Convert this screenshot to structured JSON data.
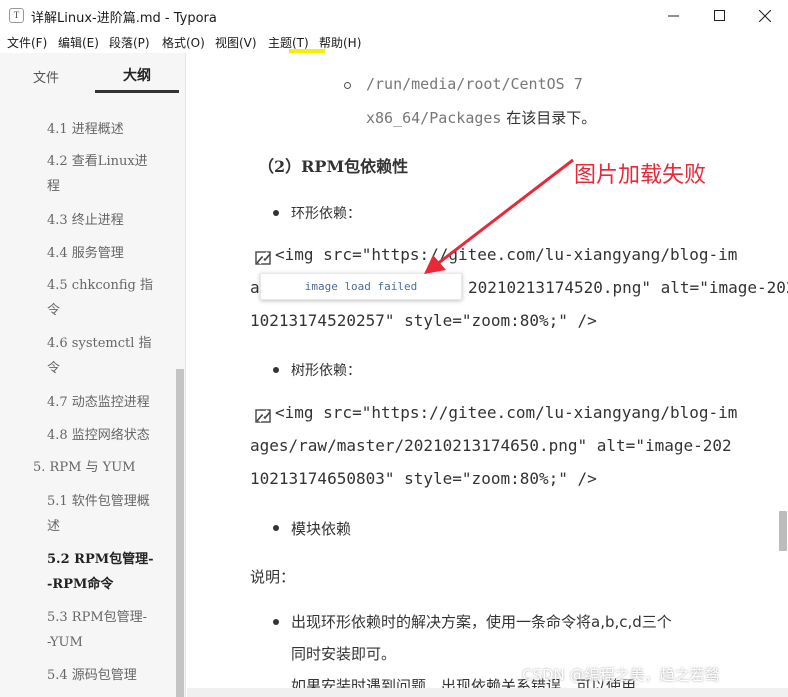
{
  "window": {
    "app_icon_letter": "T",
    "title": "详解Linux-进阶篇.md - Typora"
  },
  "menu": [
    "文件(F)",
    "编辑(E)",
    "段落(P)",
    "格式(O)",
    "视图(V)",
    "主题(T)",
    "帮助(H)"
  ],
  "sidebar": {
    "tab_files": "文件",
    "tab_outline": "大纲",
    "items": [
      {
        "label": "4.1 进程概述"
      },
      {
        "label": "4.2 查看Linux进"
      },
      {
        "label": "程"
      },
      {
        "label": "4.3 终止进程"
      },
      {
        "label": "4.4 服务管理"
      },
      {
        "label": "4.5 chkconfig 指"
      },
      {
        "label": "令"
      },
      {
        "label": "4.6 systemctl 指"
      },
      {
        "label": "令"
      },
      {
        "label": "4.7 动态监控进程"
      },
      {
        "label": "4.8 监控网络状态"
      },
      {
        "label": "5. RPM 与 YUM"
      },
      {
        "label": "5.1 软件包管理概"
      },
      {
        "label": "述"
      },
      {
        "label": "5.2 RPM包管理-"
      },
      {
        "label": "-RPM命令"
      },
      {
        "label": "5.3 RPM包管理-"
      },
      {
        "label": "-YUM"
      },
      {
        "label": "5.4 源码包管理"
      }
    ]
  },
  "editor": {
    "line1": "/run/media/root/CentOS 7",
    "line2_code": "x86_64/Packages",
    "line2_text": "在该目录下。",
    "heading": "（2）RPM包依赖性",
    "bullet1": "环形依赖：",
    "img1": {
      "line1": "<img src=\"https://gitee.com/lu-xiangyang/blog-im",
      "line2_left": "a",
      "line2_right": "20210213174520.png\" alt=\"image-202",
      "line3": "10213174520257\" style=\"zoom:80%;\" />"
    },
    "tooltip": "image load failed",
    "bullet2": "树形依赖：",
    "img2": {
      "line1": "<img src=\"https://gitee.com/lu-xiangyang/blog-im",
      "line2": "ages/raw/master/20210213174650.png\" alt=\"image-202",
      "line3": "10213174650803\" style=\"zoom:80%;\" />"
    },
    "bullet3": "模块依赖",
    "note_label": "说明：",
    "bullet4_line1": "出现环形依赖时的解决方案，使用一条命令将a,b,c,d三个",
    "bullet4_line2": "同时安装即可。",
    "partial_line": "如果安装时遇到问题，出现依赖关系错误，可以使用"
  },
  "annotation": "图片加载失败",
  "watermark": "CSDN @编程之美，趋之若鹜",
  "colors": {
    "annotation": "#e8293a",
    "highlight": "#f4f200",
    "tooltip_text": "#4a6e98"
  }
}
